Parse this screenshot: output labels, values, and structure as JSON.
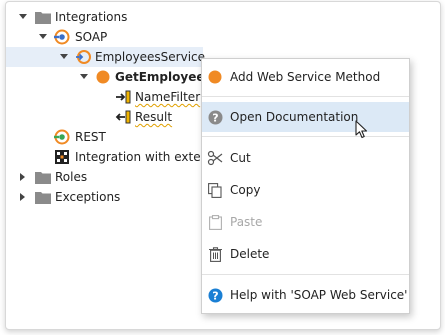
{
  "tree": {
    "integrations": "Integrations",
    "soap": "SOAP",
    "employees_service": "EmployeesService",
    "get_employee": "GetEmployee",
    "name_filter": "NameFilter",
    "result": "Result",
    "rest": "REST",
    "integration_external": "Integration with extern",
    "roles": "Roles",
    "exceptions": "Exceptions"
  },
  "context_menu": {
    "add_method": "Add Web Service Method",
    "open_docs": "Open Documentation",
    "cut": "Cut",
    "copy": "Copy",
    "paste": "Paste",
    "delete": "Delete",
    "help": "Help with 'SOAP Web Service'"
  },
  "colors": {
    "accent_orange": "#f08a24",
    "help_blue": "#1a7fd4",
    "selection": "#dce9f6",
    "folder": "#8a8a8a"
  }
}
